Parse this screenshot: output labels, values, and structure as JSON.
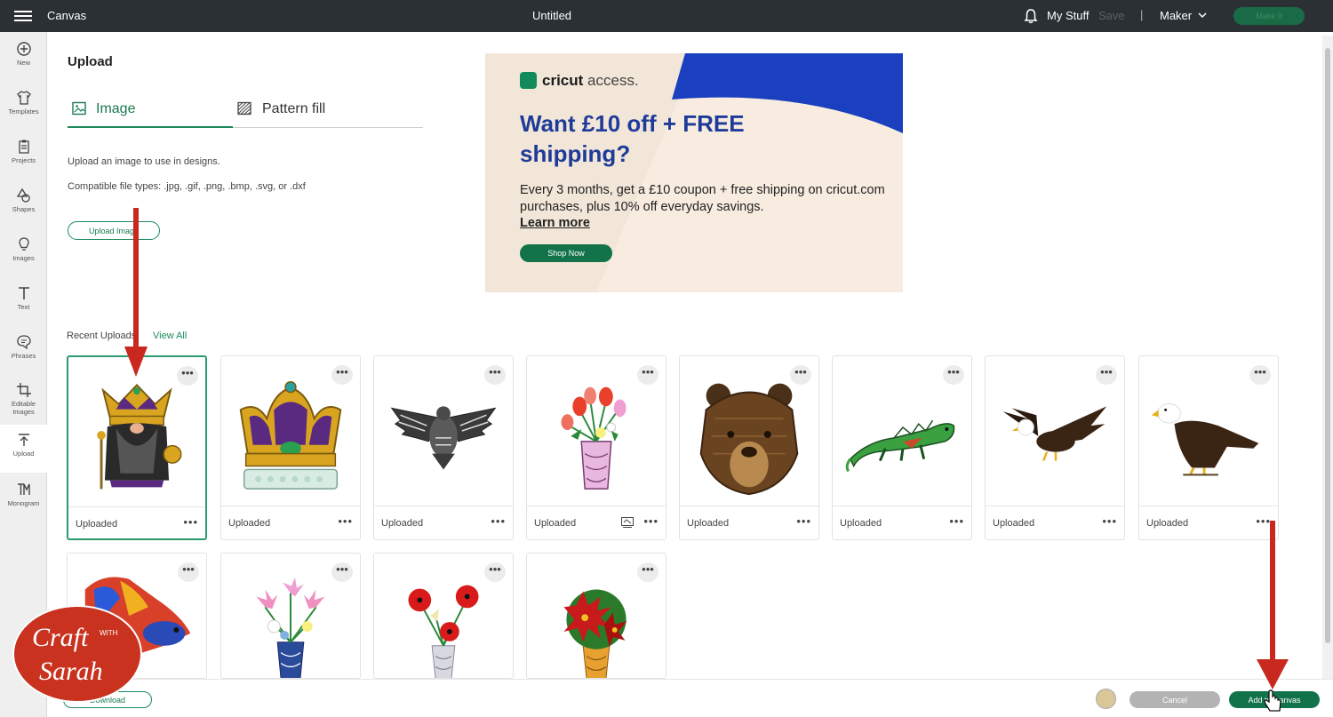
{
  "topbar": {
    "app_title": "Canvas",
    "doc_title": "Untitled",
    "my_stuff": "My Stuff",
    "save": "Save",
    "separator": "|",
    "machine": "Maker",
    "make_it": "Make It"
  },
  "sidebar": {
    "items": [
      {
        "label": "New",
        "icon": "plus-circle-icon"
      },
      {
        "label": "Templates",
        "icon": "shirt-icon"
      },
      {
        "label": "Projects",
        "icon": "clipboard-icon"
      },
      {
        "label": "Shapes",
        "icon": "shapes-icon"
      },
      {
        "label": "Images",
        "icon": "lightbulb-icon"
      },
      {
        "label": "Text",
        "icon": "text-icon"
      },
      {
        "label": "Phrases",
        "icon": "speech-bubble-icon"
      },
      {
        "label": "Editable Images",
        "icon": "crop-icon"
      },
      {
        "label": "Upload",
        "icon": "upload-icon"
      },
      {
        "label": "Monogram",
        "icon": "monogram-icon"
      }
    ]
  },
  "panel": {
    "title": "Upload",
    "tabs": [
      {
        "label": "Image",
        "icon": "image-icon"
      },
      {
        "label": "Pattern fill",
        "icon": "pattern-icon"
      }
    ],
    "desc1": "Upload an image to use in designs.",
    "desc2": "Compatible file types: .jpg, .gif, .png, .bmp, .svg, or .dxf",
    "upload_button": "Upload Image"
  },
  "ad": {
    "brand": "cricut",
    "brand_suffix": "access.",
    "headline": "Want £10 off + FREE shipping?",
    "body": "Every 3 months, get a £10 coupon + free shipping on cricut.com purchases, plus 10% off everyday savings.",
    "learn_more": "Learn more",
    "shop_now": "Shop Now"
  },
  "recent": {
    "label": "Recent Uploads",
    "view_all": "View All",
    "items": [
      {
        "status": "Uploaded",
        "image": "gnome-king-crown"
      },
      {
        "status": "Uploaded",
        "image": "royal-crown"
      },
      {
        "status": "Uploaded",
        "image": "mandala-eagle"
      },
      {
        "status": "Uploaded",
        "image": "tulip-vase"
      },
      {
        "status": "Uploaded",
        "image": "bear-head"
      },
      {
        "status": "Uploaded",
        "image": "iguana"
      },
      {
        "status": "Uploaded",
        "image": "flying-bald-eagle"
      },
      {
        "status": "Uploaded",
        "image": "perched-bald-eagle"
      },
      {
        "status": "",
        "image": "betta-fish"
      },
      {
        "status": "",
        "image": "lily-vase"
      },
      {
        "status": "",
        "image": "poppy-vase"
      },
      {
        "status": "",
        "image": "poinsettia-vase"
      }
    ]
  },
  "bottombar": {
    "download": "Download",
    "cancel": "Cancel",
    "add_to_canvas": "Add to Canvas"
  },
  "watermark": {
    "line1": "Craft",
    "with": "WITH",
    "line2": "Sarah"
  },
  "colors": {
    "topbar": "#2b3034",
    "accent": "#1b8a5a",
    "arrow": "#c8281e",
    "ad_headline": "#1e3b9a"
  }
}
